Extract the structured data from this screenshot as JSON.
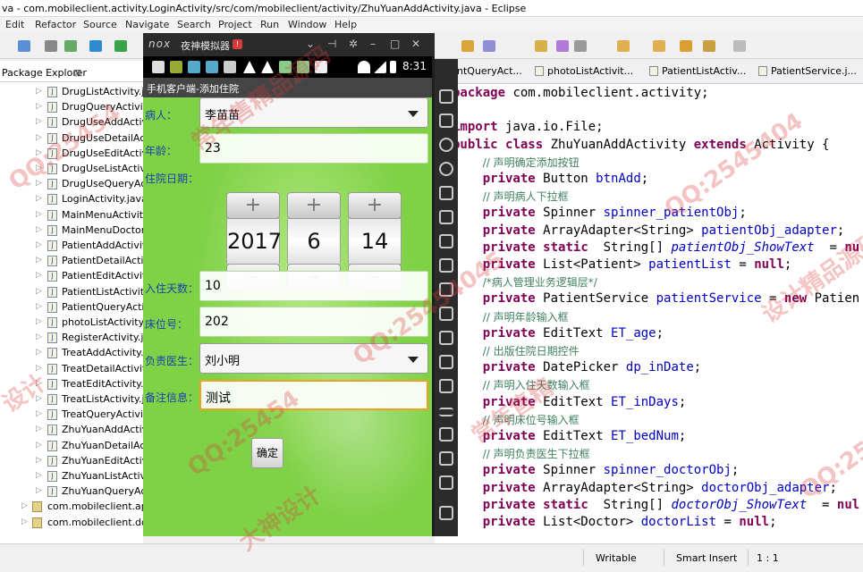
{
  "window": {
    "title": "va - com.mobileclient.activity.LoginActivity/src/com/mobileclient/activity/ZhuYuanAddActivity.java - Eclipse"
  },
  "menu": [
    "Edit",
    "Refactor",
    "Source",
    "Navigate",
    "Search",
    "Project",
    "Run",
    "Window",
    "Help"
  ],
  "package_explorer": {
    "tab_label": "Package Explorer",
    "files": [
      "DrugListActivity.java",
      "DrugQueryActivity.java",
      "DrugUseAddActivity.java",
      "DrugUseDetailActivity.java",
      "DrugUseEditActivity.java",
      "DrugUseListActivity.java",
      "DrugUseQueryActivity.java",
      "LoginActivity.java",
      "MainMenuActivity.java",
      "MainMenuDoctorActivity.java",
      "PatientAddActivity.java",
      "PatientDetailActivity.java",
      "PatientEditActivity.java",
      "PatientListActivity.java",
      "PatientQueryActivity.java",
      "photoListActivity.java",
      "RegisterActivity.java",
      "TreatAddActivity.java",
      "TreatDetailActivity.java",
      "TreatEditActivity.java",
      "TreatListActivity.java",
      "TreatQueryActivity.java",
      "ZhuYuanAddActivity.java",
      "ZhuYuanDetailActivity.java",
      "ZhuYuanEditActivity.java",
      "ZhuYuanListActivity.java",
      "ZhuYuanQueryActivity.java"
    ],
    "packages": [
      "com.mobileclient.app",
      "com.mobileclient.domain"
    ]
  },
  "editor_tabs": [
    "ntQueryAct...",
    "photoListActivit...",
    "PatientListActiv...",
    "PatientService.j..."
  ],
  "code": [
    [
      [
        "kw",
        "package"
      ],
      [
        "t",
        " com.mobileclient.activity;"
      ]
    ],
    [
      [
        "t",
        ""
      ]
    ],
    [
      [
        "kw",
        "import"
      ],
      [
        "t",
        " java.io.File;"
      ]
    ],
    [
      [
        "kw",
        "public"
      ],
      [
        "t",
        " "
      ],
      [
        "kw",
        "class"
      ],
      [
        "t",
        " ZhuYuanAddActivity "
      ],
      [
        "kw",
        "extends"
      ],
      [
        "t",
        " Activity {"
      ]
    ],
    [
      [
        "t",
        "    "
      ],
      [
        "cmt",
        "// 声明确定添加按钮"
      ]
    ],
    [
      [
        "t",
        "    "
      ],
      [
        "kw",
        "private"
      ],
      [
        "t",
        " Button "
      ],
      [
        "fld",
        "btnAdd"
      ],
      [
        "t",
        ";"
      ]
    ],
    [
      [
        "t",
        "    "
      ],
      [
        "cmt",
        "// 声明病人下拉框"
      ]
    ],
    [
      [
        "t",
        "    "
      ],
      [
        "kw",
        "private"
      ],
      [
        "t",
        " Spinner "
      ],
      [
        "fld",
        "spinner_patientObj"
      ],
      [
        "t",
        ";"
      ]
    ],
    [
      [
        "t",
        "    "
      ],
      [
        "kw",
        "private"
      ],
      [
        "t",
        " ArrayAdapter<String> "
      ],
      [
        "fld",
        "patientObj_adapter"
      ],
      [
        "t",
        ";"
      ]
    ],
    [
      [
        "t",
        "    "
      ],
      [
        "kw",
        "private"
      ],
      [
        "t",
        " "
      ],
      [
        "kw",
        "static"
      ],
      [
        "t",
        "  String[] "
      ],
      [
        "sfld",
        "patientObj_ShowText"
      ],
      [
        "t",
        "  = "
      ],
      [
        "kw",
        "nu"
      ]
    ],
    [
      [
        "t",
        "    "
      ],
      [
        "kw",
        "private"
      ],
      [
        "t",
        " List<Patient> "
      ],
      [
        "fld",
        "patientList"
      ],
      [
        "t",
        " = "
      ],
      [
        "kw",
        "null"
      ],
      [
        "t",
        ";"
      ]
    ],
    [
      [
        "t",
        "    "
      ],
      [
        "cmt",
        "/*病人管理业务逻辑层*/"
      ]
    ],
    [
      [
        "t",
        "    "
      ],
      [
        "kw",
        "private"
      ],
      [
        "t",
        " PatientService "
      ],
      [
        "fld",
        "patientService"
      ],
      [
        "t",
        " = "
      ],
      [
        "kw",
        "new"
      ],
      [
        "t",
        " Patien"
      ]
    ],
    [
      [
        "t",
        "    "
      ],
      [
        "cmt",
        "// 声明年龄输入框"
      ]
    ],
    [
      [
        "t",
        "    "
      ],
      [
        "kw",
        "private"
      ],
      [
        "t",
        " EditText "
      ],
      [
        "fld",
        "ET_age"
      ],
      [
        "t",
        ";"
      ]
    ],
    [
      [
        "t",
        "    "
      ],
      [
        "cmt",
        "// 出版住院日期控件"
      ]
    ],
    [
      [
        "t",
        "    "
      ],
      [
        "kw",
        "private"
      ],
      [
        "t",
        " DatePicker "
      ],
      [
        "fld",
        "dp_inDate"
      ],
      [
        "t",
        ";"
      ]
    ],
    [
      [
        "t",
        "    "
      ],
      [
        "cmt",
        "// 声明入住天数输入框"
      ]
    ],
    [
      [
        "t",
        "    "
      ],
      [
        "kw",
        "private"
      ],
      [
        "t",
        " EditText "
      ],
      [
        "fld",
        "ET_inDays"
      ],
      [
        "t",
        ";"
      ]
    ],
    [
      [
        "t",
        "    "
      ],
      [
        "cmt",
        "// 声明床位号输入框"
      ]
    ],
    [
      [
        "t",
        "    "
      ],
      [
        "kw",
        "private"
      ],
      [
        "t",
        " EditText "
      ],
      [
        "fld",
        "ET_bedNum"
      ],
      [
        "t",
        ";"
      ]
    ],
    [
      [
        "t",
        "    "
      ],
      [
        "cmt",
        "// 声明负责医生下拉框"
      ]
    ],
    [
      [
        "t",
        "    "
      ],
      [
        "kw",
        "private"
      ],
      [
        "t",
        " Spinner "
      ],
      [
        "fld",
        "spinner_doctorObj"
      ],
      [
        "t",
        ";"
      ]
    ],
    [
      [
        "t",
        "    "
      ],
      [
        "kw",
        "private"
      ],
      [
        "t",
        " ArrayAdapter<String> "
      ],
      [
        "fld",
        "doctorObj_adapter"
      ],
      [
        "t",
        ";"
      ]
    ],
    [
      [
        "t",
        "    "
      ],
      [
        "kw",
        "private"
      ],
      [
        "t",
        " "
      ],
      [
        "kw",
        "static"
      ],
      [
        "t",
        "  String[] "
      ],
      [
        "sfld",
        "doctorObj_ShowText"
      ],
      [
        "t",
        "  = "
      ],
      [
        "kw",
        "nul"
      ]
    ],
    [
      [
        "t",
        "    "
      ],
      [
        "kw",
        "private"
      ],
      [
        "t",
        " List<Doctor> "
      ],
      [
        "fld",
        "doctorList"
      ],
      [
        "t",
        " = "
      ],
      [
        "kw",
        "null"
      ],
      [
        "t",
        ";"
      ]
    ]
  ],
  "status": {
    "writable": "Writable",
    "insert": "Smart Insert",
    "position": "1 : 1"
  },
  "emulator": {
    "brand": "nox",
    "title": "夜神模拟器",
    "rec_badge": "!",
    "time": "8:31",
    "app_title": "手机客户端-添加住院",
    "form": {
      "patient_label": "病人：",
      "patient_value": "李苗苗",
      "age_label": "年龄：",
      "age_value": "23",
      "date_label": "住院日期：",
      "date_year": "2017",
      "date_month": "6",
      "date_day": "14",
      "days_label": "入住天数：",
      "days_value": "10",
      "bed_label": "床位号：",
      "bed_value": "202",
      "doctor_label": "负责医生：",
      "doctor_value": "刘小明",
      "note_label": "备注信息：",
      "note_value": "测试",
      "ok_label": "确定"
    }
  },
  "watermarks": [
    "QQ:25454",
    "常年售精品源码",
    "QQ:2545404",
    "设计精品源码",
    "QQ:25454045",
    "大神设计",
    "QQ:25454",
    "常年售精",
    "QQ:25454045",
    "设计"
  ]
}
